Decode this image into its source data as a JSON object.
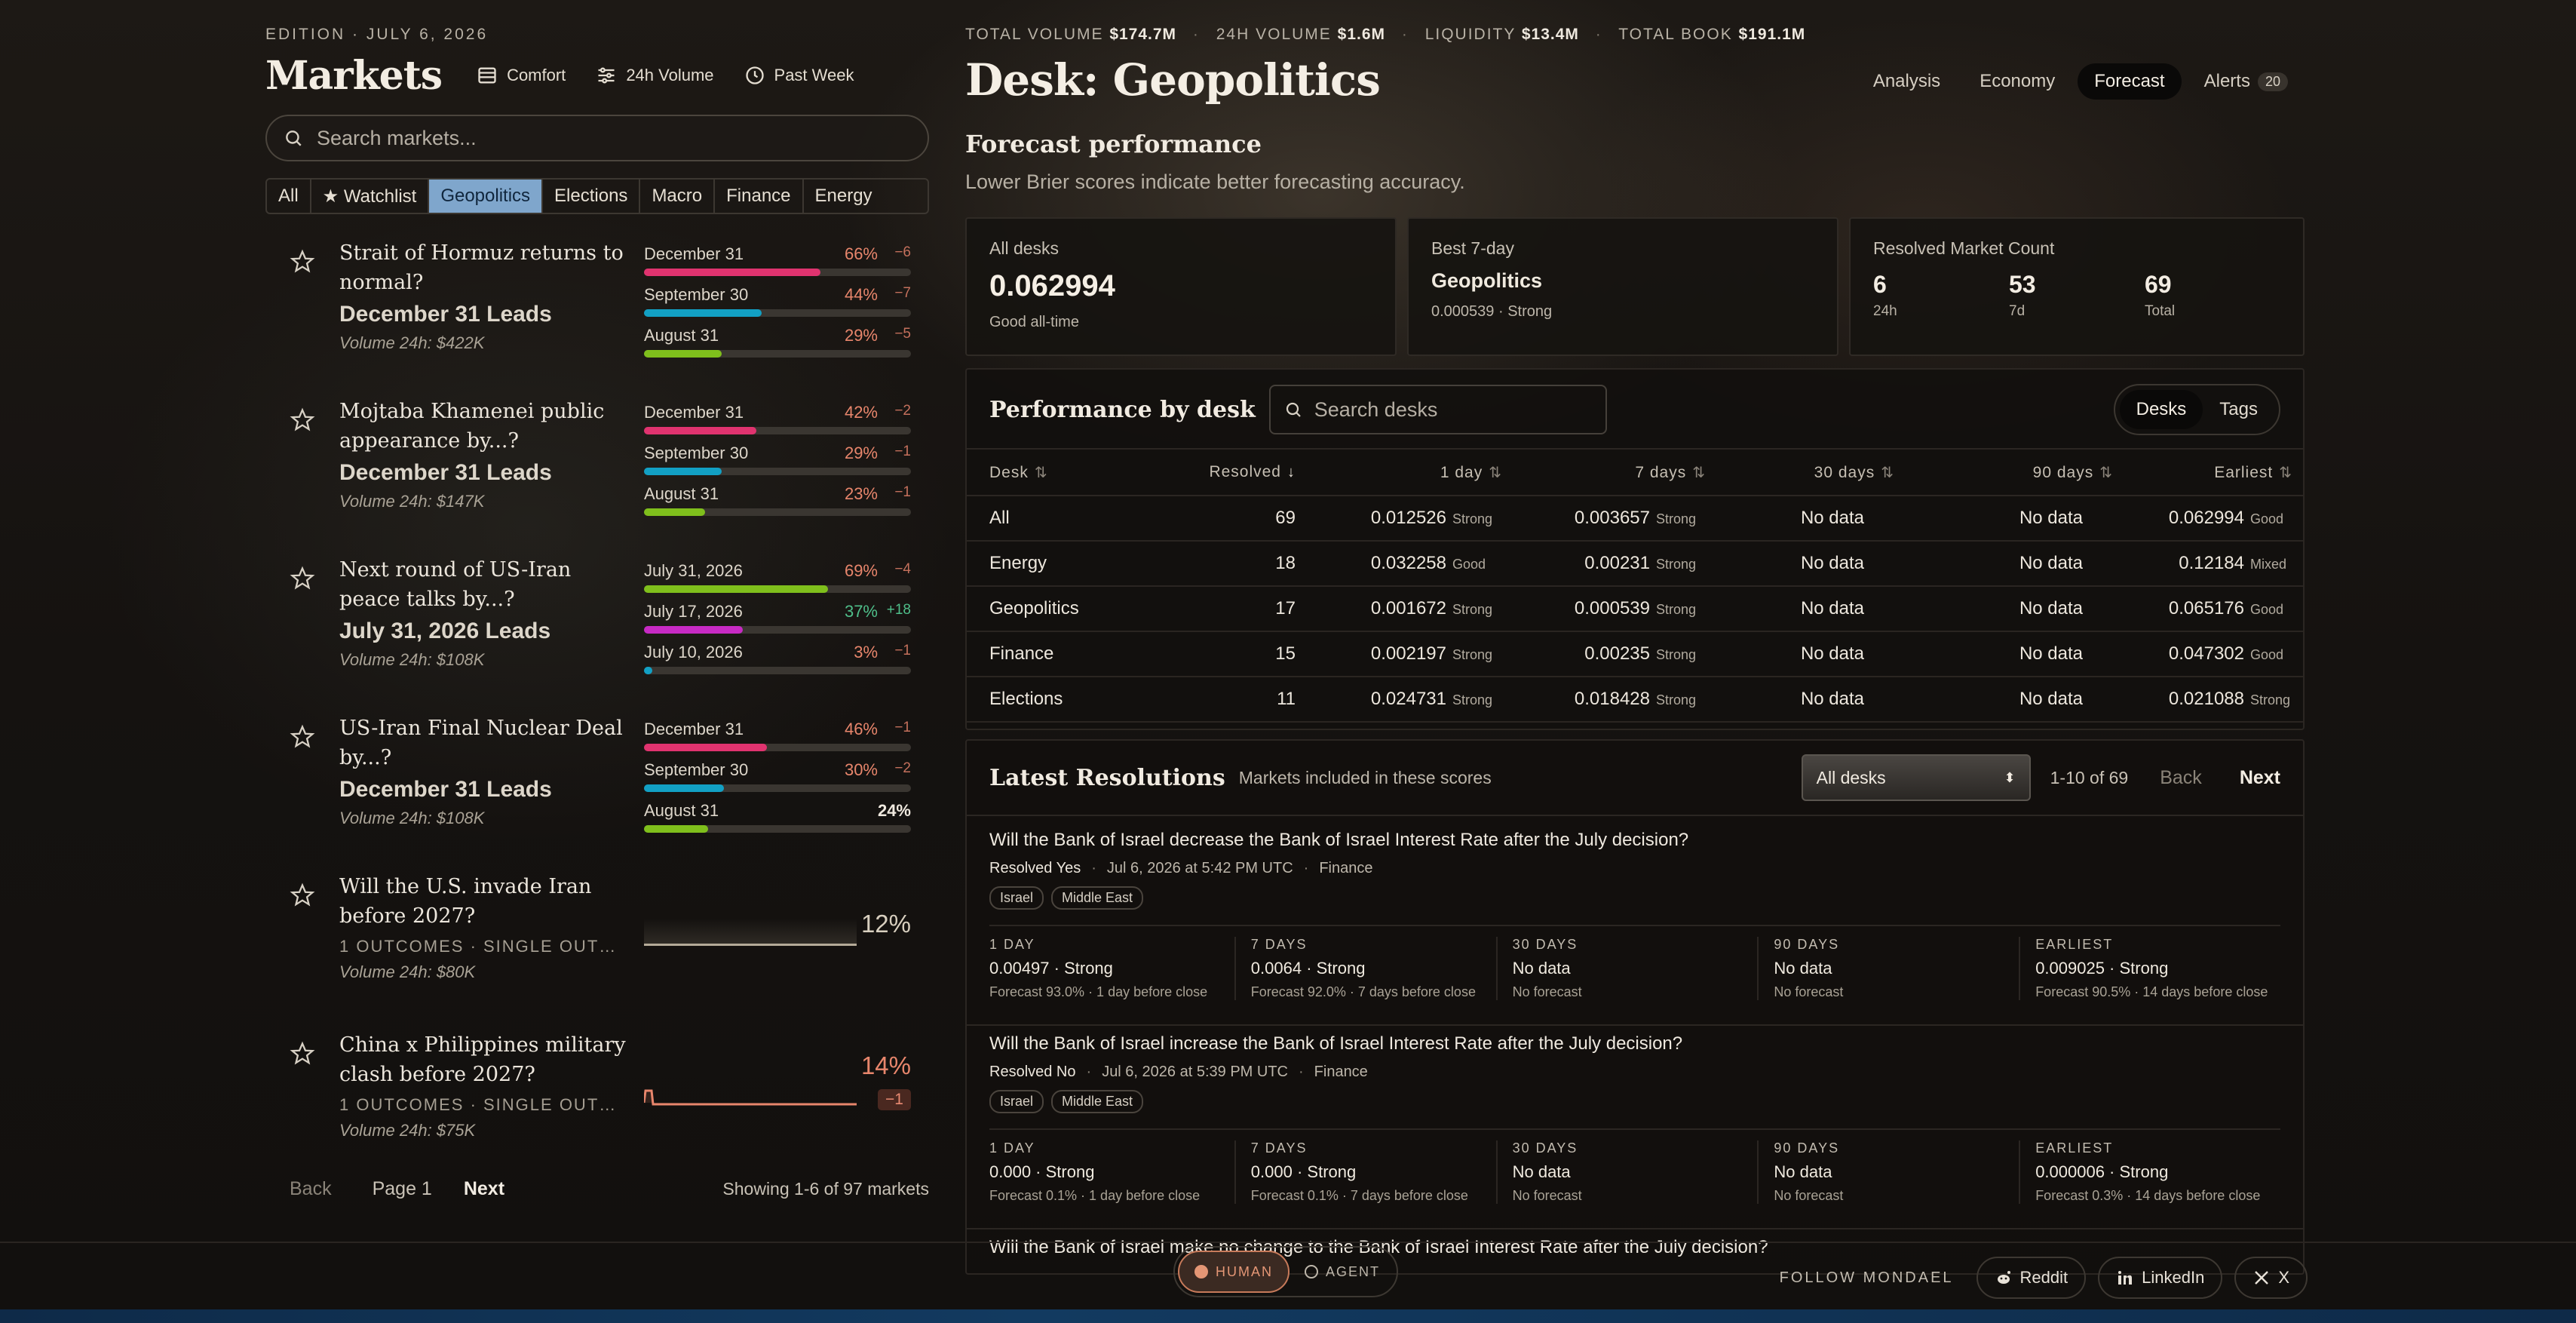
{
  "left": {
    "edition": "EDITION · JULY 6, 2026",
    "title": "Markets",
    "controls": [
      {
        "label": "Comfort",
        "icon": "layout-icon"
      },
      {
        "label": "24h Volume",
        "icon": "sliders-icon"
      },
      {
        "label": "Past Week",
        "icon": "clock-icon"
      }
    ],
    "search_placeholder": "Search markets...",
    "filters": [
      "All",
      "★ Watchlist",
      "Geopolitics",
      "Elections",
      "Macro",
      "Finance",
      "Energy"
    ],
    "active_filter": "Geopolitics",
    "markets": [
      {
        "question": "Strait of Hormuz returns to normal?",
        "lead": "December 31 Leads",
        "volume": "Volume 24h: $422K",
        "outcomes": [
          {
            "label": "December 31",
            "pct": "66%",
            "change": "−6",
            "value": 66,
            "color": "#e0336f"
          },
          {
            "label": "September 30",
            "pct": "44%",
            "change": "−7",
            "value": 44,
            "color": "#12a0c4"
          },
          {
            "label": "August 31",
            "pct": "29%",
            "change": "−5",
            "value": 29,
            "color": "#7fbf1c"
          }
        ]
      },
      {
        "question": "Mojtaba Khamenei public appearance by...?",
        "lead": "December 31 Leads",
        "volume": "Volume 24h: $147K",
        "outcomes": [
          {
            "label": "December 31",
            "pct": "42%",
            "change": "−2",
            "value": 42,
            "color": "#e0336f"
          },
          {
            "label": "September 30",
            "pct": "29%",
            "change": "−1",
            "value": 29,
            "color": "#12a0c4"
          },
          {
            "label": "August 31",
            "pct": "23%",
            "change": "−1",
            "value": 23,
            "color": "#7fbf1c"
          }
        ]
      },
      {
        "question": "Next round of US-Iran peace talks by...?",
        "lead": "July 31, 2026 Leads",
        "volume": "Volume 24h: $108K",
        "outcomes": [
          {
            "label": "July 31, 2026",
            "pct": "69%",
            "change": "−4",
            "value": 69,
            "color": "#7fbf1c"
          },
          {
            "label": "July 17, 2026",
            "pct": "37%",
            "change": "+18",
            "value": 37,
            "color": "#c72ac4"
          },
          {
            "label": "July 10, 2026",
            "pct": "3%",
            "change": "−1",
            "value": 3,
            "color": "#12a0c4"
          }
        ]
      },
      {
        "question": "US-Iran Final Nuclear Deal by...?",
        "lead": "December 31 Leads",
        "volume": "Volume 24h: $108K",
        "outcomes": [
          {
            "label": "December 31",
            "pct": "46%",
            "change": "−1",
            "value": 46,
            "color": "#e0336f"
          },
          {
            "label": "September 30",
            "pct": "30%",
            "change": "−2",
            "value": 30,
            "color": "#12a0c4"
          },
          {
            "label": "August 31",
            "pct": "24%",
            "change": "",
            "value": 24,
            "color": "#7fbf1c"
          }
        ]
      },
      {
        "question": "Will the U.S. invade Iran before 2027?",
        "sub": "1 OUTCOMES · SINGLE OUTCOME",
        "volume": "Volume 24h: $80K",
        "single_pct": "12%",
        "single_color": "#d8cfbf"
      },
      {
        "question": "China x Philippines military clash before 2027?",
        "sub": "1 OUTCOMES · SINGLE OUTCOME",
        "volume": "Volume 24h: $75K",
        "single_pct": "14%",
        "single_change": "−1",
        "single_color": "#e8866c"
      }
    ],
    "pager": {
      "back": "Back",
      "page": "Page 1",
      "next": "Next",
      "showing": "Showing 1-6 of 97 markets"
    }
  },
  "right": {
    "stats": [
      {
        "label": "TOTAL VOLUME",
        "value": "$174.7M"
      },
      {
        "label": "24H VOLUME",
        "value": "$1.6M"
      },
      {
        "label": "LIQUIDITY",
        "value": "$13.4M"
      },
      {
        "label": "TOTAL BOOK",
        "value": "$191.1M"
      }
    ],
    "title": "Desk: Geopolitics",
    "tabs": [
      {
        "label": "Analysis"
      },
      {
        "label": "Economy"
      },
      {
        "label": "Forecast",
        "active": true
      },
      {
        "label": "Alerts",
        "badge": "20"
      }
    ],
    "fp_title": "Forecast performance",
    "fp_sub": "Lower Brier scores indicate better forecasting accuracy.",
    "cards": {
      "all": {
        "title": "All desks",
        "value": "0.062994",
        "note": "Good all-time"
      },
      "best": {
        "title": "Best 7-day",
        "value": "Geopolitics",
        "note": "0.000539 · Strong"
      },
      "count": {
        "title": "Resolved Market Count",
        "items": [
          {
            "n": "6",
            "u": "24h"
          },
          {
            "n": "53",
            "u": "7d"
          },
          {
            "n": "69",
            "u": "Total"
          }
        ]
      }
    },
    "perf": {
      "title": "Performance by desk",
      "search_placeholder": "Search desks",
      "toggle": [
        "Desks",
        "Tags"
      ],
      "columns": [
        "Desk",
        "Resolved",
        "1 day",
        "7 days",
        "30 days",
        "90 days",
        "Earliest"
      ],
      "rows": [
        {
          "desk": "All",
          "resolved": "69",
          "d1": "0.012526",
          "d1q": "Strong",
          "d7": "0.003657",
          "d7q": "Strong",
          "d30": "No data",
          "d90": "No data",
          "ear": "0.062994",
          "earq": "Good"
        },
        {
          "desk": "Energy",
          "resolved": "18",
          "d1": "0.032258",
          "d1q": "Good",
          "d7": "0.00231",
          "d7q": "Strong",
          "d30": "No data",
          "d90": "No data",
          "ear": "0.12184",
          "earq": "Mixed"
        },
        {
          "desk": "Geopolitics",
          "resolved": "17",
          "d1": "0.001672",
          "d1q": "Strong",
          "d7": "0.000539",
          "d7q": "Strong",
          "d30": "No data",
          "d90": "No data",
          "ear": "0.065176",
          "earq": "Good"
        },
        {
          "desk": "Finance",
          "resolved": "15",
          "d1": "0.002197",
          "d1q": "Strong",
          "d7": "0.00235",
          "d7q": "Strong",
          "d30": "No data",
          "d90": "No data",
          "ear": "0.047302",
          "earq": "Good"
        },
        {
          "desk": "Elections",
          "resolved": "11",
          "d1": "0.024731",
          "d1q": "Strong",
          "d7": "0.018428",
          "d7q": "Strong",
          "d30": "No data",
          "d90": "No data",
          "ear": "0.021088",
          "earq": "Strong"
        }
      ]
    },
    "latest": {
      "title": "Latest Resolutions",
      "sub": "Markets included in these scores",
      "select": "All desks",
      "range": "1-10 of 69",
      "back": "Back",
      "next": "Next",
      "items": [
        {
          "question": "Will the Bank of Israel decrease the Bank of Israel Interest Rate after the July decision?",
          "resolved": "Resolved Yes",
          "time": "Jul 6, 2026 at 5:42 PM UTC",
          "desk": "Finance",
          "tags": [
            "Israel",
            "Middle East"
          ],
          "grid": [
            {
              "h": "1 DAY",
              "v": "0.00497 · Strong",
              "s": "Forecast 93.0% · 1 day before close"
            },
            {
              "h": "7 DAYS",
              "v": "0.0064 · Strong",
              "s": "Forecast 92.0% · 7 days before close"
            },
            {
              "h": "30 DAYS",
              "v": "No data",
              "s": "No forecast"
            },
            {
              "h": "90 DAYS",
              "v": "No data",
              "s": "No forecast"
            },
            {
              "h": "EARLIEST",
              "v": "0.009025 · Strong",
              "s": "Forecast 90.5% · 14 days before close"
            }
          ]
        },
        {
          "question": "Will the Bank of Israel increase the Bank of Israel Interest Rate after the July decision?",
          "resolved": "Resolved No",
          "time": "Jul 6, 2026 at 5:39 PM UTC",
          "desk": "Finance",
          "tags": [
            "Israel",
            "Middle East"
          ],
          "grid": [
            {
              "h": "1 DAY",
              "v": "0.000 · Strong",
              "s": "Forecast 0.1% · 1 day before close"
            },
            {
              "h": "7 DAYS",
              "v": "0.000 · Strong",
              "s": "Forecast 0.1% · 7 days before close"
            },
            {
              "h": "30 DAYS",
              "v": "No data",
              "s": "No forecast"
            },
            {
              "h": "90 DAYS",
              "v": "No data",
              "s": "No forecast"
            },
            {
              "h": "EARLIEST",
              "v": "0.000006 · Strong",
              "s": "Forecast 0.3% · 14 days before close"
            }
          ]
        },
        {
          "question": "Will the Bank of Israel make no change to the Bank of Israel Interest Rate after the July decision?"
        }
      ]
    }
  },
  "footer": {
    "mode_human": "HUMAN",
    "mode_agent": "AGENT",
    "follow": "FOLLOW MONDAEL",
    "socials": [
      "Reddit",
      "LinkedIn",
      "X"
    ]
  }
}
